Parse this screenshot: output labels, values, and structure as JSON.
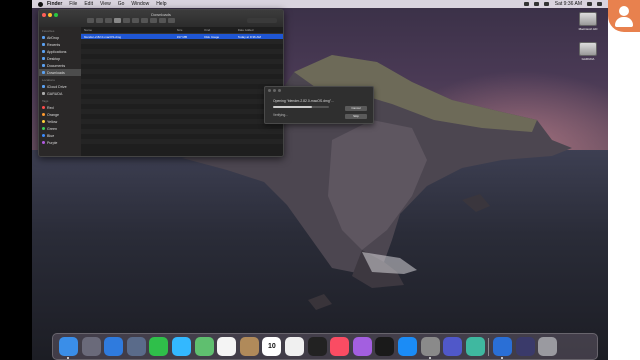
{
  "menubar": {
    "app_name": "Finder",
    "items": [
      "File",
      "Edit",
      "View",
      "Go",
      "Window",
      "Help"
    ],
    "clock": "Sat 9:36 AM"
  },
  "desktop": {
    "disks": [
      {
        "label": "Macintosh HD"
      },
      {
        "label": "GARUDA"
      }
    ]
  },
  "finder": {
    "title": "Downloads",
    "sidebar": {
      "favorites_header": "Favorites",
      "favorites": [
        "AirDrop",
        "Recents",
        "Applications",
        "Desktop",
        "Documents",
        "Downloads"
      ],
      "locations_header": "Locations",
      "locations": [
        "iCloud Drive",
        "GARUDA"
      ],
      "tags_header": "Tags",
      "tags": [
        {
          "label": "Red",
          "color": "#ff4b4b"
        },
        {
          "label": "Orange",
          "color": "#ff9a2e"
        },
        {
          "label": "Yellow",
          "color": "#ffd23a"
        },
        {
          "label": "Green",
          "color": "#3ccf5a"
        },
        {
          "label": "Blue",
          "color": "#3a8bff"
        },
        {
          "label": "Purple",
          "color": "#b05ae0"
        }
      ]
    },
    "columns": {
      "name": "Name",
      "size": "Size",
      "kind": "Kind",
      "date": "Date Added"
    },
    "files": [
      {
        "name": "blender-2.82.0-macOS.dmg",
        "size": "197 MB",
        "kind": "Disk Image",
        "date": "Today at 9:36 AM"
      }
    ]
  },
  "dialog": {
    "opening_text": "Opening “blender-2.82.0-macOS.dmg”...",
    "status_text": "Verifying...",
    "progress": 0.7,
    "cancel_label": "Cancel",
    "skip_label": "Skip"
  },
  "dock": {
    "apps": [
      {
        "name": "finder",
        "color": "#3a8ee8"
      },
      {
        "name": "launchpad",
        "color": "#6a6a7a"
      },
      {
        "name": "safari",
        "color": "#2f7bde"
      },
      {
        "name": "preview",
        "color": "#5a6b8a"
      },
      {
        "name": "facetime",
        "color": "#2fbf4a"
      },
      {
        "name": "messages",
        "color": "#33b8ff"
      },
      {
        "name": "maps",
        "color": "#5fbf6f"
      },
      {
        "name": "photos",
        "color": "#f4f4f4"
      },
      {
        "name": "contacts",
        "color": "#b08a5a"
      },
      {
        "name": "calendar",
        "color": "#ffffff",
        "text": "10"
      },
      {
        "name": "reminders",
        "color": "#f0f0f0"
      },
      {
        "name": "tv",
        "color": "#222222"
      },
      {
        "name": "music",
        "color": "#fa4c63"
      },
      {
        "name": "podcasts",
        "color": "#a35fe0"
      },
      {
        "name": "apple-tv",
        "color": "#1a1a1a"
      },
      {
        "name": "app-store",
        "color": "#1b8cf6"
      },
      {
        "name": "system-preferences",
        "color": "#8a8a8a"
      },
      {
        "name": "teams",
        "color": "#5058c9"
      },
      {
        "name": "app-green",
        "color": "#3fb8a0"
      },
      {
        "name": "blender",
        "color": "#2a6fd6"
      },
      {
        "name": "screenshot",
        "color": "#3a3a6a"
      },
      {
        "name": "trash",
        "color": "#9a9aa0"
      }
    ]
  }
}
